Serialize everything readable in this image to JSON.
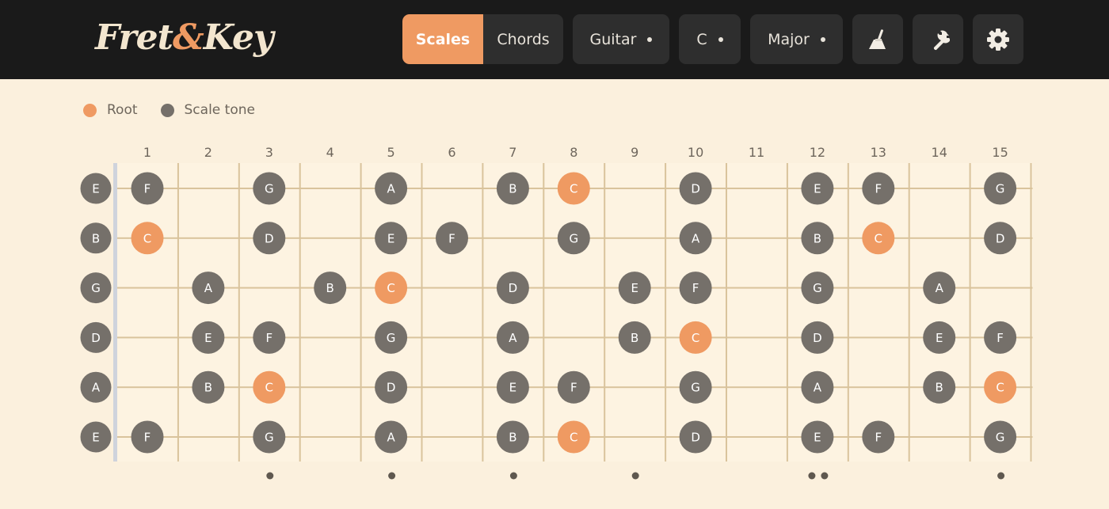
{
  "app": {
    "logo_part1": "Fret",
    "logo_amp": "&",
    "logo_part2": "Key"
  },
  "header": {
    "mode_tabs": [
      {
        "label": "Scales",
        "active": true
      },
      {
        "label": "Chords",
        "active": false
      }
    ],
    "instrument": "Guitar",
    "key": "C",
    "scale": "Major",
    "icons": [
      "broom-icon",
      "wrench-icon",
      "gear-icon"
    ]
  },
  "legend": {
    "root_label": "Root",
    "tone_label": "Scale tone"
  },
  "colors": {
    "root": "#ef9a62",
    "tone": "#75706a",
    "accent": "#ef9a62",
    "fretboard": "#fdf3e1",
    "fret_line": "#d9c39c",
    "nut": "#cfd3dc",
    "inlay": "#5f584f"
  },
  "fretboard": {
    "fret_numbers": [
      "1",
      "2",
      "3",
      "4",
      "5",
      "6",
      "7",
      "8",
      "9",
      "10",
      "11",
      "12",
      "13",
      "14",
      "15"
    ],
    "strings": [
      {
        "open": "E",
        "notes": {
          "1": "F",
          "3": "G",
          "5": "A",
          "7": "B",
          "8": "C",
          "10": "D",
          "12": "E",
          "13": "F",
          "15": "G"
        }
      },
      {
        "open": "B",
        "notes": {
          "1": "C",
          "3": "D",
          "5": "E",
          "6": "F",
          "8": "G",
          "10": "A",
          "12": "B",
          "13": "C",
          "15": "D"
        }
      },
      {
        "open": "G",
        "notes": {
          "2": "A",
          "4": "B",
          "5": "C",
          "7": "D",
          "9": "E",
          "10": "F",
          "12": "G",
          "14": "A"
        }
      },
      {
        "open": "D",
        "notes": {
          "2": "E",
          "3": "F",
          "5": "G",
          "7": "A",
          "9": "B",
          "10": "C",
          "12": "D",
          "14": "E",
          "15": "F"
        }
      },
      {
        "open": "A",
        "notes": {
          "2": "B",
          "3": "C",
          "5": "D",
          "7": "E",
          "8": "F",
          "10": "G",
          "12": "A",
          "14": "B",
          "15": "C"
        }
      },
      {
        "open": "E",
        "notes": {
          "1": "F",
          "3": "G",
          "5": "A",
          "7": "B",
          "8": "C",
          "10": "D",
          "12": "E",
          "13": "F",
          "15": "G"
        }
      }
    ],
    "root_note": "C",
    "inlay_frets": [
      3,
      5,
      7,
      9,
      15
    ],
    "double_inlay_frets": [
      12
    ]
  }
}
